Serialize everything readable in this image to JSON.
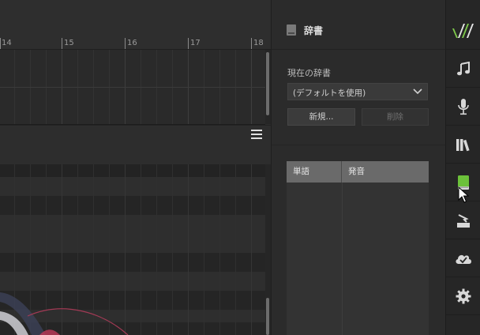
{
  "ruler": {
    "measures": [
      {
        "label": "14"
      },
      {
        "label": "15"
      },
      {
        "label": "16"
      },
      {
        "label": "17"
      },
      {
        "label": "18"
      }
    ]
  },
  "dictionary": {
    "title": "辞書",
    "current_label": "現在の辞書",
    "select_value": "(デフォルトを使用)",
    "new_button": "新規...",
    "delete_button": "削除",
    "table": {
      "col_word": "単語",
      "col_pronunciation": "発音",
      "rows": []
    }
  },
  "sidebar": {
    "items": [
      {
        "name": "logo-icon"
      },
      {
        "name": "music-note-icon"
      },
      {
        "name": "microphone-icon"
      },
      {
        "name": "library-icon"
      },
      {
        "name": "dictionary-icon",
        "active": true
      },
      {
        "name": "export-icon"
      },
      {
        "name": "cloud-icon"
      },
      {
        "name": "gear-icon"
      }
    ]
  },
  "colors": {
    "accent_green": "#6cc13a",
    "logo_green": "#7ec84b",
    "background": "#2b2b2b",
    "table_header": "#6a6a6a"
  }
}
